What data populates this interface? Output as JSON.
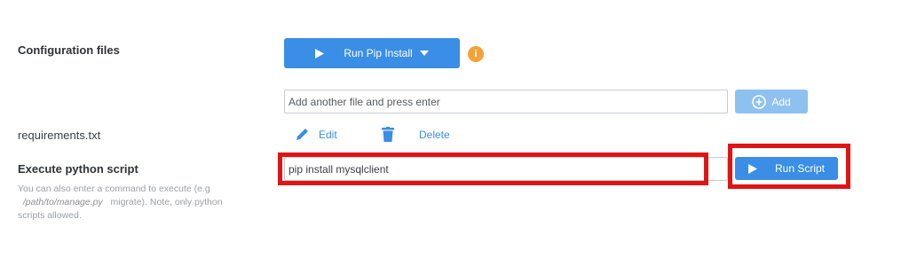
{
  "config": {
    "label": "Configuration files",
    "run_pip_label": "Run Pip Install",
    "info_icon_text": "i",
    "add_file_placeholder": "Add another file and press enter",
    "add_label": "Add"
  },
  "file": {
    "name": "requirements.txt",
    "edit_label": "Edit",
    "delete_label": "Delete"
  },
  "execute": {
    "label": "Execute python script",
    "hint_prefix": "You can also enter a command to execute (e.g",
    "hint_path": "/path/to/manage.py",
    "hint_suffix": "migrate). Note, only python scripts allowed.",
    "command_value": "pip install mysqlclient",
    "run_script_label": "Run Script"
  },
  "colors": {
    "primary": "#3a8ee6",
    "primary_light": "#8fc1f0",
    "info": "#f3a23a",
    "highlight": "#e01414"
  }
}
